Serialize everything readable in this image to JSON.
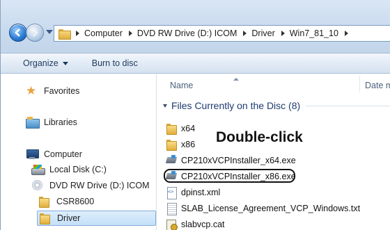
{
  "address_bar": {
    "crumbs": [
      "Computer",
      "DVD RW Drive (D:) ICOM",
      "Driver",
      "Win7_81_10"
    ]
  },
  "toolbar": {
    "organize_label": "Organize",
    "burn_label": "Burn to disc"
  },
  "navigation": {
    "favorites_label": "Favorites",
    "libraries_label": "Libraries",
    "computer_label": "Computer",
    "local_disk_label": "Local Disk (C:)",
    "dvd_label": "DVD RW Drive (D:) ICOM",
    "csr_label": "CSR8600",
    "driver_label": "Driver"
  },
  "content": {
    "col_name": "Name",
    "col_date": "Date m",
    "group_label": "Files Currently on the Disc (8)",
    "files": [
      {
        "name": "x64",
        "icon": "folder-icon"
      },
      {
        "name": "x86",
        "icon": "folder-icon"
      },
      {
        "name": "CP210xVCPInstaller_x64.exe",
        "icon": "exe-icon"
      },
      {
        "name": "CP210xVCPInstaller_x86.exe",
        "icon": "exe-icon"
      },
      {
        "name": "dpinst.xml",
        "icon": "xml-file-icon"
      },
      {
        "name": "SLAB_License_Agreement_VCP_Windows.txt",
        "icon": "text-file-icon"
      },
      {
        "name": "slabvcp.cat",
        "icon": "catalog-file-icon"
      }
    ]
  },
  "annotation": {
    "callout": "Double-click"
  }
}
